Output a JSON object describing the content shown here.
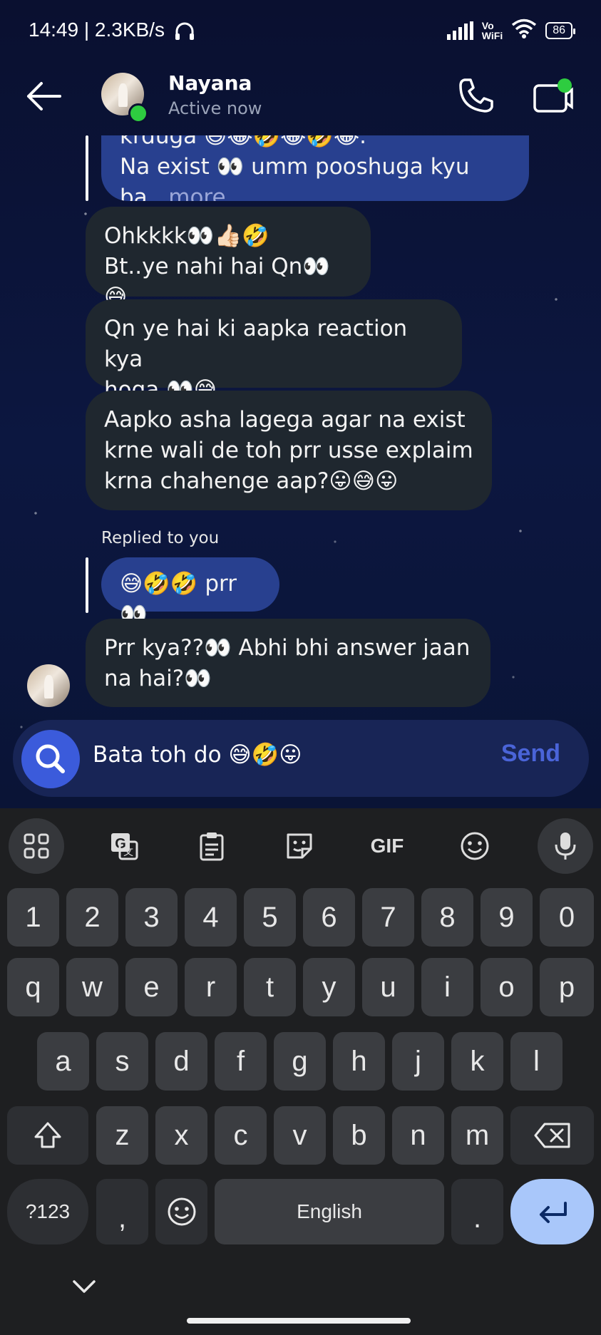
{
  "status_bar": {
    "time": "14:49 | 2.3KB/s",
    "network": "Vo\nWiFi",
    "battery": "86"
  },
  "header": {
    "name": "Nayana",
    "status": "Active now"
  },
  "messages": [
    {
      "line1": "krduga 😅😂🤣😂🤣😂.",
      "line2": "Na exist 👀 umm pooshuga kyu ba",
      "more": "...more"
    },
    {
      "line1": "Ohkkkk👀👍🏻🤣",
      "line2": "Bt..ye nahi hai Qn👀😅"
    },
    {
      "line1": "Qn ye hai ki aapka reaction kya",
      "line2": "hoga 👀😅"
    },
    {
      "line1": "Aapko asha lagega agar na exist",
      "line2": "krne wali de toh prr usse  explaim",
      "line3": "krna chahenge aap?😛😅😛"
    },
    {
      "label": "Replied to you",
      "text": "😅🤣🤣 prr 👀"
    },
    {
      "line1": "Prr kya??👀 Abhi bhi answer jaan",
      "line2": "na hai?👀"
    }
  ],
  "composer": {
    "text": "Bata toh do 😅🤣😛",
    "send_label": "Send"
  },
  "keyboard": {
    "toolbar": [
      "apps-grid",
      "translate",
      "clipboard",
      "sticker",
      "GIF",
      "emoji",
      "mic"
    ],
    "gif_label": "GIF",
    "row_numbers": [
      "1",
      "2",
      "3",
      "4",
      "5",
      "6",
      "7",
      "8",
      "9",
      "0"
    ],
    "row1": [
      "q",
      "w",
      "e",
      "r",
      "t",
      "y",
      "u",
      "i",
      "o",
      "p"
    ],
    "row2": [
      "a",
      "s",
      "d",
      "f",
      "g",
      "h",
      "j",
      "k",
      "l"
    ],
    "row3": [
      "z",
      "x",
      "c",
      "v",
      "b",
      "n",
      "m"
    ],
    "sym_label": "?123",
    "comma": ",",
    "space_label": "English",
    "period": "."
  },
  "colors": {
    "bubble_incoming": "#1f272f",
    "bubble_reply": "#28408f",
    "accent": "#3b5bdb",
    "enter_key": "#a9c7fa"
  }
}
